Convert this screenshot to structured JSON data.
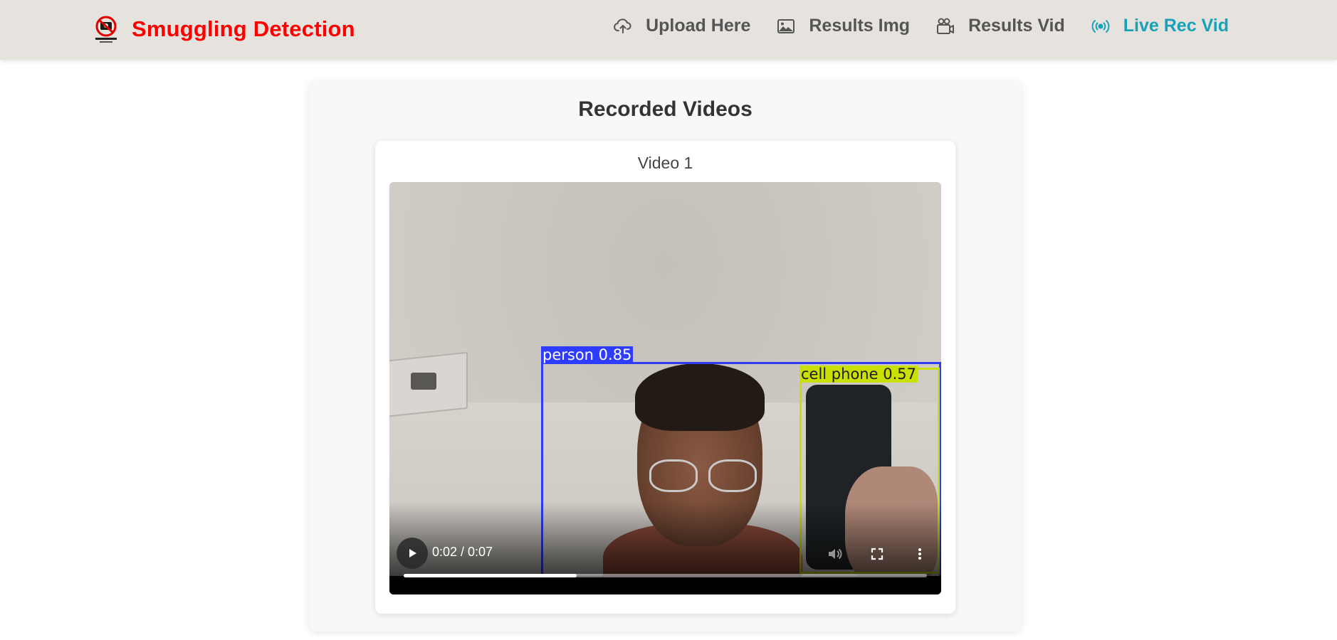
{
  "header": {
    "logo_icon": "no-smuggling-logo",
    "brand_title": "Smuggling Detection",
    "nav": [
      {
        "label": "Upload Here",
        "icon": "cloud-upload-icon",
        "active": false
      },
      {
        "label": "Results Img",
        "icon": "image-icon",
        "active": false
      },
      {
        "label": "Results Vid",
        "icon": "video-camera-icon",
        "active": false
      },
      {
        "label": "Live Rec Vid",
        "icon": "broadcast-icon",
        "active": true
      }
    ],
    "brand_color": "#ff0000",
    "active_color": "#17a2b8"
  },
  "main": {
    "section_title": "Recorded Videos",
    "videos": [
      {
        "title": "Video 1",
        "detections": [
          {
            "label": "person 0.85",
            "color": "#2d3cff"
          },
          {
            "label": "cell phone 0.57",
            "color": "#c9e000"
          }
        ],
        "player": {
          "time_display": "0:02 / 0:07",
          "progress_fraction": 0.33
        }
      }
    ]
  }
}
